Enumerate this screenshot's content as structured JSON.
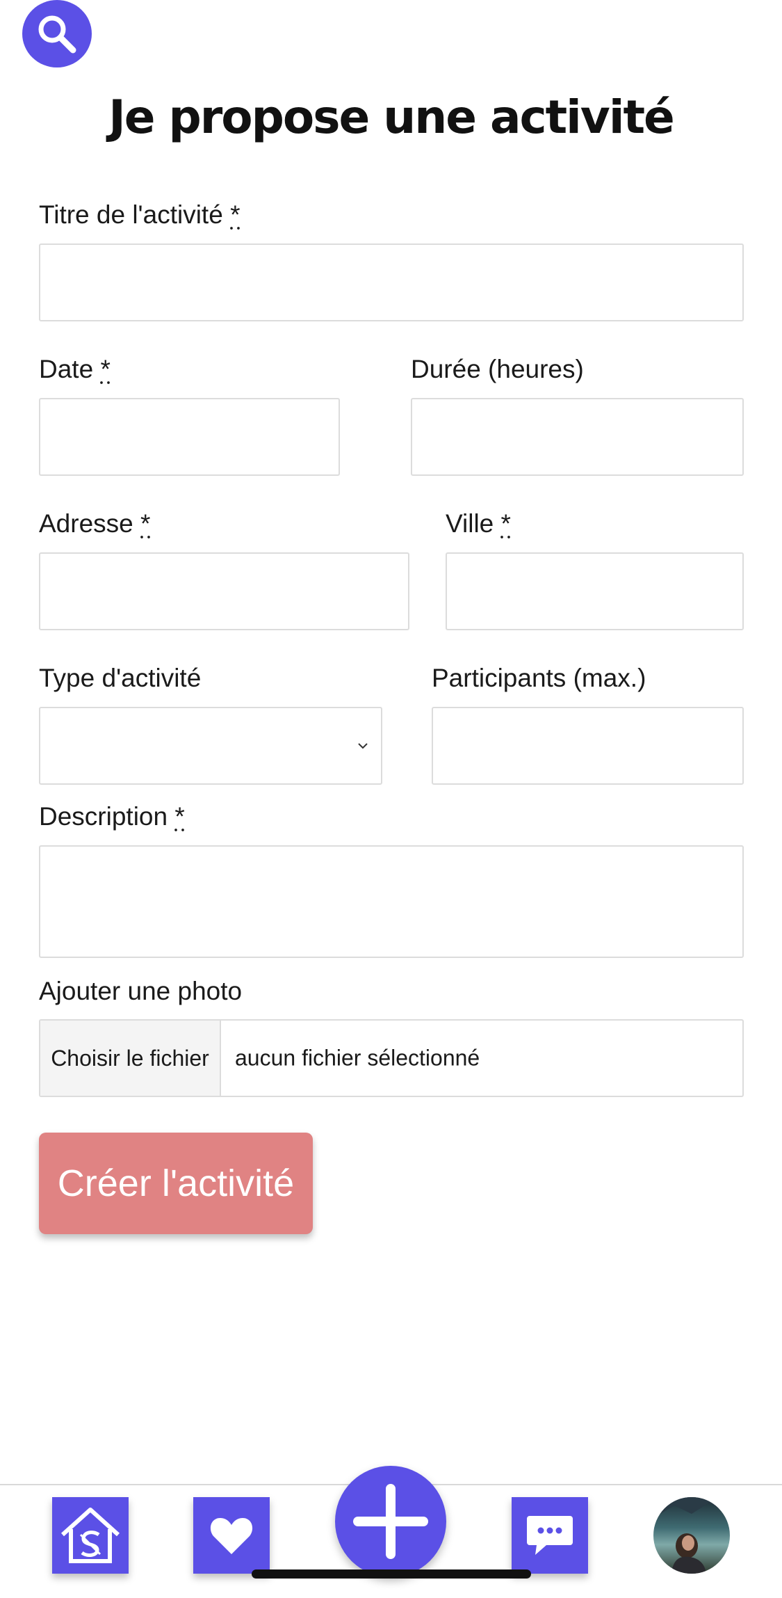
{
  "header": {
    "title": "Je propose une activité"
  },
  "form": {
    "title_label": "Titre de l'activité",
    "date_label": "Date",
    "duration_label": "Durée (heures)",
    "address_label": "Adresse",
    "city_label": "Ville",
    "type_label": "Type d'activité",
    "type_selected": "",
    "participants_label": "Participants (max.)",
    "description_label": "Description",
    "photo_label": "Ajouter une photo",
    "file_button": "Choisir le fichier",
    "file_status": "aucun fichier sélectionné",
    "required_mark": "*",
    "submit_label": "Créer l'activité"
  },
  "nav": {
    "items": [
      "home-icon",
      "heart-icon",
      "plus-icon",
      "chat-icon",
      "avatar"
    ]
  },
  "colors": {
    "accent": "#5b50e6",
    "submit_disabled": "#e08383",
    "input_border": "#dcdcdc"
  }
}
